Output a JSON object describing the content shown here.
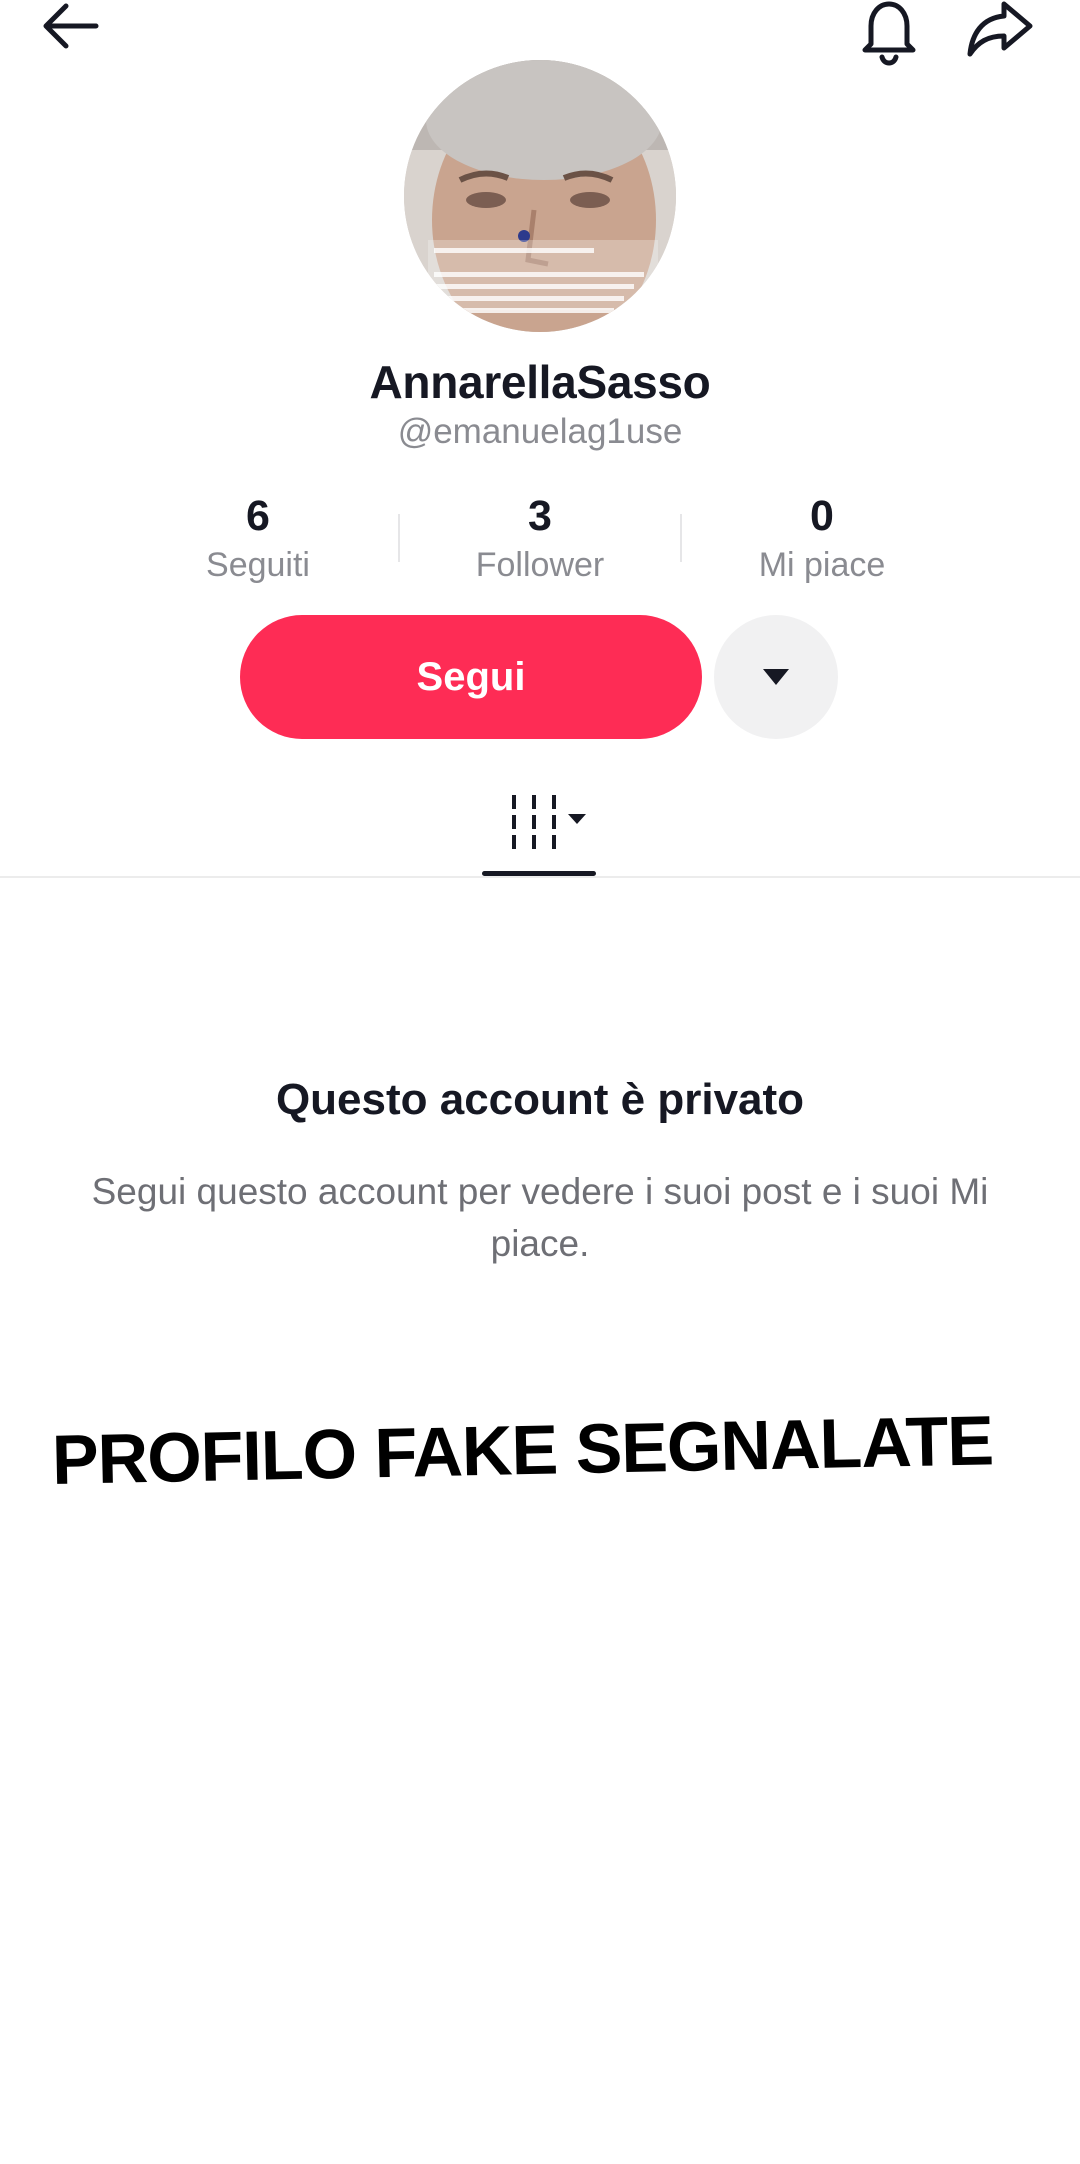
{
  "header": {
    "back_icon": "arrow-left-icon",
    "bell_icon": "bell-icon",
    "share_icon": "share-arrow-icon"
  },
  "profile": {
    "avatar_icon": "profile-avatar",
    "display_name": "AnnarellaSasso",
    "username": "@emanuelag1use"
  },
  "stats": [
    {
      "value": "6",
      "label": "Seguiti"
    },
    {
      "value": "3",
      "label": "Follower"
    },
    {
      "value": "0",
      "label": "Mi piace"
    }
  ],
  "actions": {
    "follow_label": "Segui",
    "dropdown_icon": "triangle-down-icon"
  },
  "tabs": {
    "active_icon": "grid-videos-icon"
  },
  "private": {
    "title": "Questo account è privato",
    "description": "Segui questo account per vedere i suoi post e i suoi Mi piace."
  },
  "overlay": {
    "text": "PROFILO FAKE SEGNALATE"
  },
  "colors": {
    "accent": "#fe2c55",
    "text_primary": "#161823",
    "text_secondary": "#8a8b91",
    "secondary_button_bg": "#f1f1f2"
  }
}
